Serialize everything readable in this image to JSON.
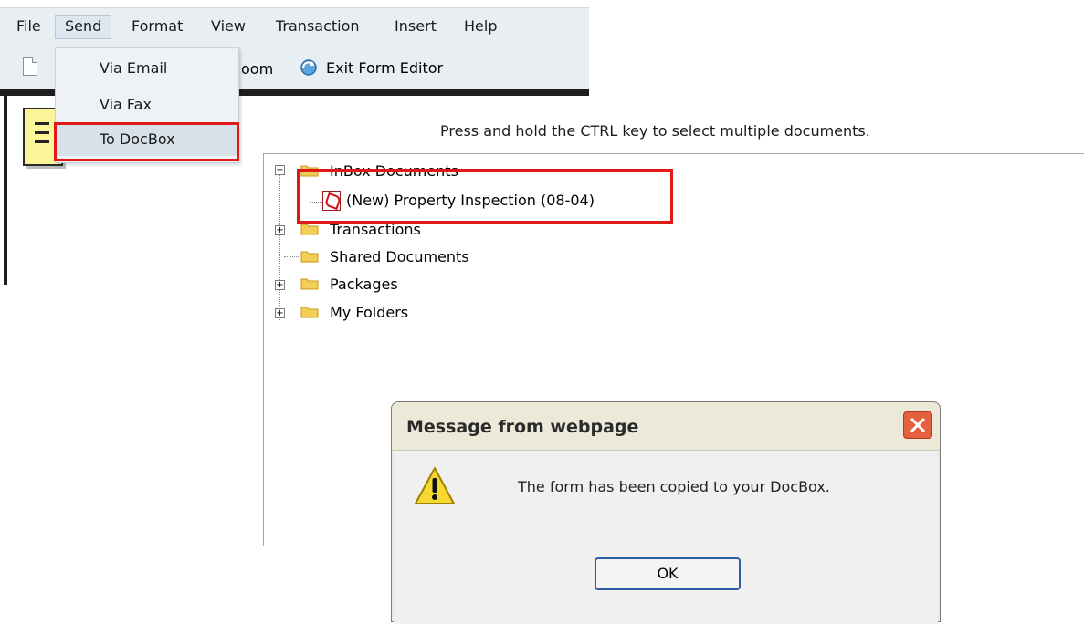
{
  "menubar": {
    "items": [
      "File",
      "Send",
      "Format",
      "View",
      "Transaction",
      "Insert",
      "Help"
    ]
  },
  "toolbar": {
    "zoom_fragment": "oom",
    "exit_label": "Exit Form Editor"
  },
  "send_menu": {
    "items": [
      "Via Email",
      "Via Fax",
      "To DocBox"
    ]
  },
  "chooser": {
    "hint": "Press and hold the CTRL key to select multiple documents.",
    "tree": [
      {
        "label": "InBox Documents",
        "expander": "−"
      },
      {
        "label": "(New) Property Inspection (08-04)"
      },
      {
        "label": "Transactions",
        "expander": "+"
      },
      {
        "label": "Shared Documents"
      },
      {
        "label": "Packages",
        "expander": "+"
      },
      {
        "label": "My Folders",
        "expander": "+"
      }
    ]
  },
  "dialog": {
    "title": "Message from webpage",
    "message": "The form has been copied to your DocBox.",
    "ok_label": "OK"
  },
  "colors": {
    "highlight_box": "#e01818",
    "menubar_bg": "#e9eef3",
    "dialog_bg": "#ece9d8"
  }
}
